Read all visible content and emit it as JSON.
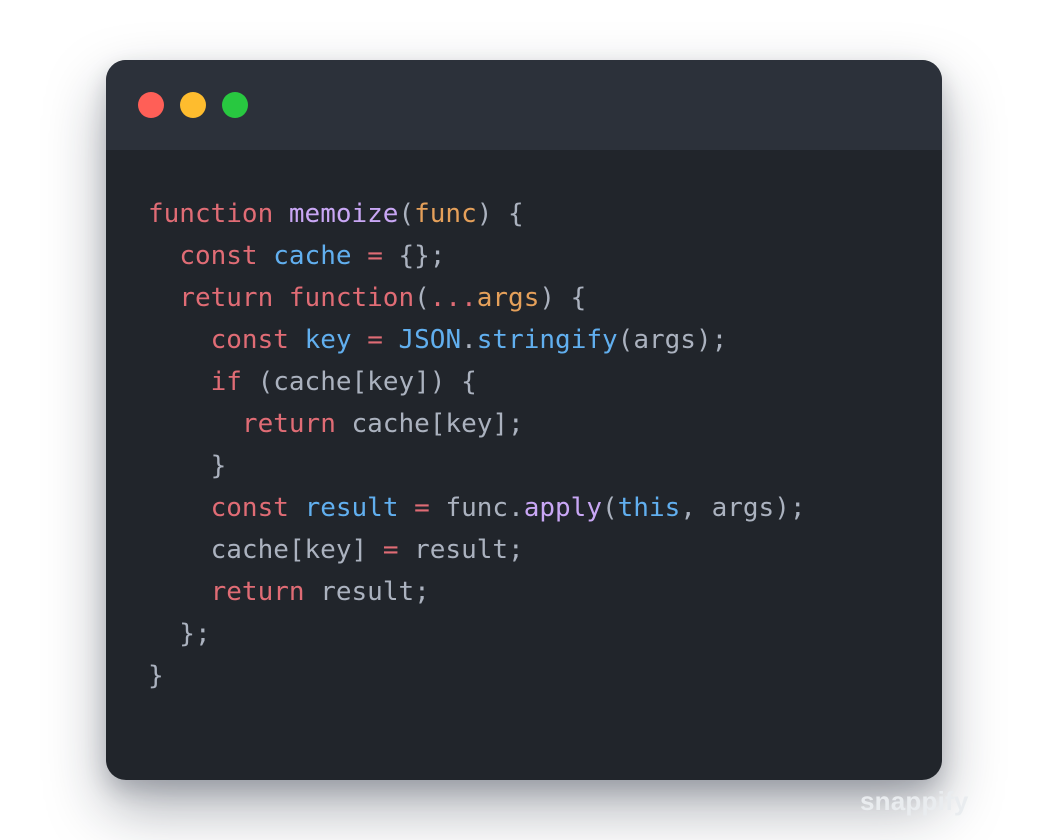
{
  "window": {
    "controls": [
      {
        "name": "close",
        "color": "#ff5f57"
      },
      {
        "name": "minimize",
        "color": "#febc2e"
      },
      {
        "name": "zoom",
        "color": "#28c840"
      }
    ]
  },
  "theme": {
    "background": "#21252b",
    "titlebar": "#2c313a",
    "default_text": "#abb2bf",
    "keyword": "#e06c75",
    "function_name": "#c9a7f5",
    "parameter": "#e5a05a",
    "variable": "#61afef",
    "punctuation": "#abb2bf"
  },
  "code": {
    "language": "javascript",
    "lines": [
      [
        {
          "t": "function",
          "c": "keyword"
        },
        {
          "t": " ",
          "c": "default_text"
        },
        {
          "t": "memoize",
          "c": "function_name"
        },
        {
          "t": "(",
          "c": "punctuation"
        },
        {
          "t": "func",
          "c": "parameter"
        },
        {
          "t": ") {",
          "c": "punctuation"
        }
      ],
      [
        {
          "t": "  ",
          "c": "default_text"
        },
        {
          "t": "const",
          "c": "keyword"
        },
        {
          "t": " ",
          "c": "default_text"
        },
        {
          "t": "cache",
          "c": "variable"
        },
        {
          "t": " ",
          "c": "default_text"
        },
        {
          "t": "=",
          "c": "keyword"
        },
        {
          "t": " {};",
          "c": "punctuation"
        }
      ],
      [
        {
          "t": "  ",
          "c": "default_text"
        },
        {
          "t": "return",
          "c": "keyword"
        },
        {
          "t": " ",
          "c": "default_text"
        },
        {
          "t": "function",
          "c": "keyword"
        },
        {
          "t": "(",
          "c": "punctuation"
        },
        {
          "t": "...",
          "c": "keyword"
        },
        {
          "t": "args",
          "c": "parameter"
        },
        {
          "t": ") {",
          "c": "punctuation"
        }
      ],
      [
        {
          "t": "    ",
          "c": "default_text"
        },
        {
          "t": "const",
          "c": "keyword"
        },
        {
          "t": " ",
          "c": "default_text"
        },
        {
          "t": "key",
          "c": "variable"
        },
        {
          "t": " ",
          "c": "default_text"
        },
        {
          "t": "=",
          "c": "keyword"
        },
        {
          "t": " ",
          "c": "default_text"
        },
        {
          "t": "JSON",
          "c": "variable"
        },
        {
          "t": ".",
          "c": "punctuation"
        },
        {
          "t": "stringify",
          "c": "variable"
        },
        {
          "t": "(args);",
          "c": "punctuation"
        }
      ],
      [
        {
          "t": "    ",
          "c": "default_text"
        },
        {
          "t": "if",
          "c": "keyword"
        },
        {
          "t": " (cache[key]) {",
          "c": "punctuation"
        }
      ],
      [
        {
          "t": "      ",
          "c": "default_text"
        },
        {
          "t": "return",
          "c": "keyword"
        },
        {
          "t": " cache[key];",
          "c": "punctuation"
        }
      ],
      [
        {
          "t": "    }",
          "c": "punctuation"
        }
      ],
      [
        {
          "t": "    ",
          "c": "default_text"
        },
        {
          "t": "const",
          "c": "keyword"
        },
        {
          "t": " ",
          "c": "default_text"
        },
        {
          "t": "result",
          "c": "variable"
        },
        {
          "t": " ",
          "c": "default_text"
        },
        {
          "t": "=",
          "c": "keyword"
        },
        {
          "t": " func.",
          "c": "punctuation"
        },
        {
          "t": "apply",
          "c": "function_name"
        },
        {
          "t": "(",
          "c": "punctuation"
        },
        {
          "t": "this",
          "c": "variable"
        },
        {
          "t": ", args);",
          "c": "punctuation"
        }
      ],
      [
        {
          "t": "    cache[key] ",
          "c": "punctuation"
        },
        {
          "t": "=",
          "c": "keyword"
        },
        {
          "t": " result;",
          "c": "punctuation"
        }
      ],
      [
        {
          "t": "    ",
          "c": "default_text"
        },
        {
          "t": "return",
          "c": "keyword"
        },
        {
          "t": " result;",
          "c": "punctuation"
        }
      ],
      [
        {
          "t": "  };",
          "c": "punctuation"
        }
      ],
      [
        {
          "t": "}",
          "c": "punctuation"
        }
      ]
    ]
  },
  "watermark": {
    "text": "snappify"
  }
}
